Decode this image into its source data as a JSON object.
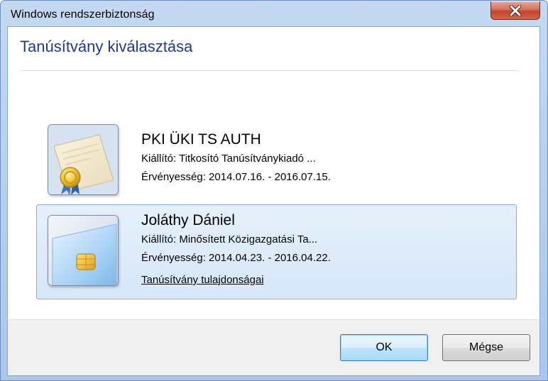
{
  "window": {
    "title": "Windows rendszerbiztonság"
  },
  "dialog": {
    "heading": "Tanúsítvány kiválasztása"
  },
  "certificates": [
    {
      "name": "PKI ÜKI TS AUTH",
      "issuer": "Kiállító: Titkosító Tanúsítványkiadó ...",
      "validity": "Érvényesség: 2014.07.16. - 2016.07.15.",
      "icon": "certificate-seal-icon",
      "selected": false
    },
    {
      "name": "Joláthy Dániel",
      "issuer": "Kiállító: Minősített Közigazgatási Ta...",
      "validity": "Érvényesség: 2014.04.23. - 2016.04.22.",
      "link": "Tanúsítvány tulajdonságai",
      "icon": "smart-card-icon",
      "selected": true
    }
  ],
  "buttons": {
    "ok": "OK",
    "cancel": "Mégse"
  },
  "colors": {
    "heading": "#1e3a8f",
    "selection_border": "#87aedb",
    "close_button": "#c7523c"
  }
}
